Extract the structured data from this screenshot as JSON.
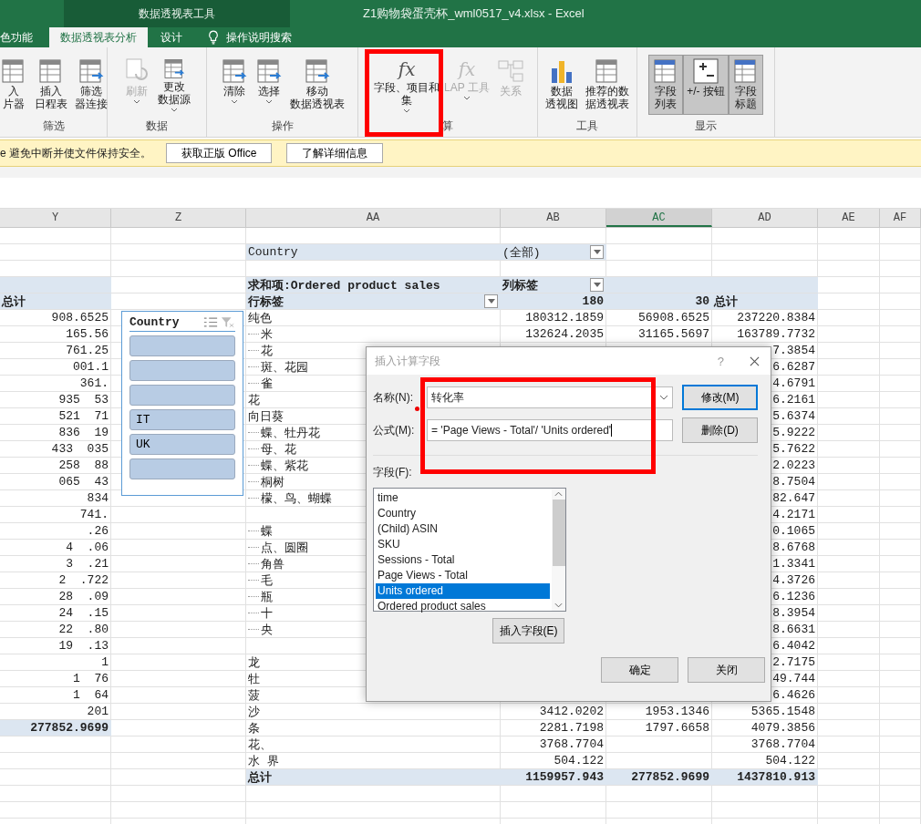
{
  "title_bar": {
    "context_tab": "数据透视表工具",
    "title": "Z1购物袋蛋壳杯_wml0517_v4.xlsx  -  Excel"
  },
  "tabs": [
    {
      "label": "色功能",
      "selected": false
    },
    {
      "label": "数据透视表分析",
      "selected": true
    },
    {
      "label": "设计",
      "selected": false
    }
  ],
  "tell_me": "操作说明搜索",
  "ribbon_groups": [
    {
      "label": "筛选",
      "buttons": [
        {
          "lines": [
            "入",
            "片器"
          ],
          "disabled": false,
          "pressed": false,
          "dropdown": false
        },
        {
          "lines": [
            "插入",
            "日程表"
          ],
          "disabled": false,
          "pressed": false,
          "dropdown": false
        },
        {
          "lines": [
            "筛选",
            "器连接"
          ],
          "disabled": false,
          "pressed": false,
          "dropdown": false
        }
      ]
    },
    {
      "label": "数据",
      "buttons": [
        {
          "lines": [
            "刷新"
          ],
          "disabled": true,
          "pressed": false,
          "dropdown": true
        },
        {
          "lines": [
            "更改",
            "数据源"
          ],
          "disabled": false,
          "pressed": false,
          "dropdown": true
        }
      ]
    },
    {
      "label": "操作",
      "buttons": [
        {
          "lines": [
            "清除"
          ],
          "disabled": false,
          "pressed": false,
          "dropdown": true
        },
        {
          "lines": [
            "选择"
          ],
          "disabled": false,
          "pressed": false,
          "dropdown": true
        },
        {
          "lines": [
            "移动",
            "数据透视表"
          ],
          "disabled": false,
          "pressed": false,
          "dropdown": false
        }
      ]
    },
    {
      "label": "算",
      "buttons": [
        {
          "lines": [
            "字段、项目和",
            "集"
          ],
          "icon_text": "fx",
          "disabled": false,
          "pressed": false,
          "dropdown": true
        },
        {
          "lines": [
            "LAP 工具"
          ],
          "icon_text": "fx",
          "disabled": true,
          "pressed": false,
          "dropdown": true
        },
        {
          "lines": [
            "关系"
          ],
          "disabled": true,
          "pressed": false,
          "dropdown": false
        }
      ]
    },
    {
      "label": "工具",
      "buttons": [
        {
          "lines": [
            "数据",
            "透视图"
          ],
          "disabled": false,
          "pressed": false,
          "dropdown": false
        },
        {
          "lines": [
            "推荐的数",
            "据透视表"
          ],
          "disabled": false,
          "pressed": false,
          "dropdown": false
        }
      ]
    },
    {
      "label": "显示",
      "buttons": [
        {
          "lines": [
            "字段",
            "列表"
          ],
          "disabled": false,
          "pressed": true,
          "dropdown": false
        },
        {
          "lines": [
            "+/- 按钮"
          ],
          "disabled": false,
          "pressed": true,
          "dropdown": false
        },
        {
          "lines": [
            "字段",
            "标题"
          ],
          "disabled": false,
          "pressed": true,
          "dropdown": false
        }
      ]
    }
  ],
  "message_bar": {
    "text": "e 避免中断并使文件保持安全。",
    "buttons": [
      "获取正版 Office",
      "了解详细信息"
    ]
  },
  "columns": [
    {
      "label": "Y",
      "selected": false
    },
    {
      "label": "Z",
      "selected": false
    },
    {
      "label": "AA",
      "selected": false
    },
    {
      "label": "AB",
      "selected": false
    },
    {
      "label": "AC",
      "selected": true
    },
    {
      "label": "AD",
      "selected": false
    },
    {
      "label": "AE",
      "selected": false
    },
    {
      "label": "AF",
      "selected": false
    }
  ],
  "report_filter": {
    "field": "Country",
    "value": "(全部)"
  },
  "left_pivot": {
    "header": "总计",
    "values": [
      "908.6525",
      "165.56",
      "761.25",
      "001.1",
      "361.",
      "935  53",
      "521  71",
      "836  19",
      "433  035",
      "258  88",
      "065  43",
      "834",
      "741.",
      ".26",
      "4  .06",
      "3  .21",
      "2  .722",
      "28  .09",
      "24  .15",
      "22  .80",
      "19  .13",
      "1",
      "1  76",
      "1  64",
      "201"
    ],
    "grand_total": "277852.9699"
  },
  "pivot": {
    "title": "求和项:Ordered product sales",
    "column_label": "列标签",
    "row_label": "行标签",
    "column_values": [
      "180",
      "30",
      "总计"
    ],
    "rows": [
      {
        "label": "纯色",
        "kind": "item",
        "col_180": "180312.1859",
        "col_30": "56908.6525",
        "total": "237220.8384"
      },
      {
        "label": "米",
        "kind": "branch",
        "col_180": "132624.2035",
        "col_30": "31165.5697",
        "total": "163789.7732"
      },
      {
        "label": "花",
        "kind": "branch",
        "total": "7.3854"
      },
      {
        "label": "斑、花园",
        "kind": "branch",
        "total": "6.6287"
      },
      {
        "label": "雀",
        "kind": "branch",
        "total": "4.6791"
      },
      {
        "label": "花",
        "kind": "item",
        "total": "6.2161"
      },
      {
        "label": "向日葵",
        "kind": "item",
        "total": "5.6374"
      },
      {
        "label": "蝶、牡丹花",
        "kind": "branch",
        "total": "5.9222"
      },
      {
        "label": "母、花",
        "kind": "branch",
        "total": "5.7622"
      },
      {
        "label": "蝶、紫花",
        "kind": "branch",
        "total": "2.0223"
      },
      {
        "label": "桐树",
        "kind": "branch",
        "total": "8.7504"
      },
      {
        "label": "檬、鸟、蝴蝶",
        "kind": "branch",
        "total": "82.647"
      },
      {
        "kind": "item",
        "total": "4.2171"
      },
      {
        "label": "蝶",
        "kind": "branch",
        "total": "0.1065"
      },
      {
        "label": "点、圆圈",
        "kind": "branch",
        "total": "8.6768"
      },
      {
        "label": "角兽",
        "kind": "branch",
        "total": "1.3341"
      },
      {
        "label": "毛",
        "kind": "branch",
        "total": "4.3726"
      },
      {
        "label": "瓶",
        "kind": "branch",
        "total": "6.1236"
      },
      {
        "label": "十",
        "kind": "branch",
        "total": "8.3954"
      },
      {
        "label": "央",
        "kind": "branch",
        "total": "8.6631"
      },
      {
        "kind": "item",
        "total": "6.4042"
      },
      {
        "label": "龙",
        "kind": "item",
        "total": "2.7175"
      },
      {
        "label": "牡",
        "kind": "item",
        "total": "49.744"
      },
      {
        "label": "菠",
        "kind": "item",
        "total": "6.4626"
      },
      {
        "label": "沙",
        "kind": "item",
        "col_180": "3412.0202",
        "col_30": "1953.1346",
        "total": "5365.1548"
      },
      {
        "label": "条",
        "kind": "item",
        "col_180": "2281.7198",
        "col_30": "1797.6658",
        "total": "4079.3856"
      },
      {
        "label": "花、",
        "kind": "item",
        "col_180": "3768.7704",
        "total": "3768.7704"
      },
      {
        "label": "水  界",
        "kind": "item",
        "col_180": "504.122",
        "total": "504.122"
      }
    ],
    "grand_total": {
      "label": "总计",
      "values": [
        "1159957.943",
        "277852.9699",
        "1437810.913"
      ]
    }
  },
  "slicer": {
    "title": "Country",
    "items": [
      {
        "selected": true
      },
      {
        "selected": true
      },
      {
        "selected": true
      },
      {
        "label": "IT",
        "selected": true
      },
      {
        "label": "UK",
        "selected": true
      },
      {
        "selected": true
      }
    ]
  },
  "dialog": {
    "title": "插入计算字段",
    "help": "?",
    "name_label": "名称(N):",
    "name_value": "转化率",
    "formula_label": "公式(M):",
    "formula_value": "= 'Page Views - Total'/ 'Units ordered'",
    "side_buttons": [
      {
        "label": "修改(M)",
        "default": true
      },
      {
        "label": "删除(D)",
        "default": false
      }
    ],
    "fields_label": "字段(F):",
    "fields": [
      {
        "label": "time",
        "selected": false
      },
      {
        "label": "Country",
        "selected": false
      },
      {
        "label": "(Child) ASIN",
        "selected": false
      },
      {
        "label": "SKU",
        "selected": false
      },
      {
        "label": "Sessions - Total",
        "selected": false
      },
      {
        "label": "Page Views - Total",
        "selected": false
      },
      {
        "label": "Units ordered",
        "selected": true
      },
      {
        "label": "Ordered product sales",
        "selected": false
      }
    ],
    "insert_button": "插入字段(E)",
    "footer_buttons": [
      "确定",
      "关闭"
    ]
  }
}
